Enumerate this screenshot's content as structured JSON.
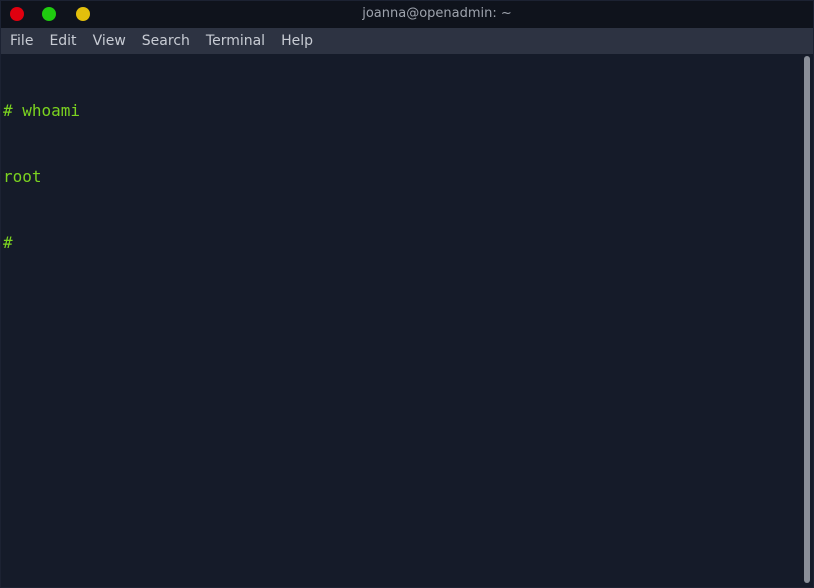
{
  "window": {
    "title": "joanna@openadmin: ~",
    "buttons": {
      "close_color": "#e0000f",
      "maximize_color": "#1fcb0f",
      "minimize_color": "#e2bf0c"
    }
  },
  "menu": {
    "items": [
      "File",
      "Edit",
      "View",
      "Search",
      "Terminal",
      "Help"
    ]
  },
  "terminal": {
    "lines": [
      "# whoami",
      "root",
      "#"
    ],
    "text_color": "#7bd320",
    "background": "#151b29"
  }
}
